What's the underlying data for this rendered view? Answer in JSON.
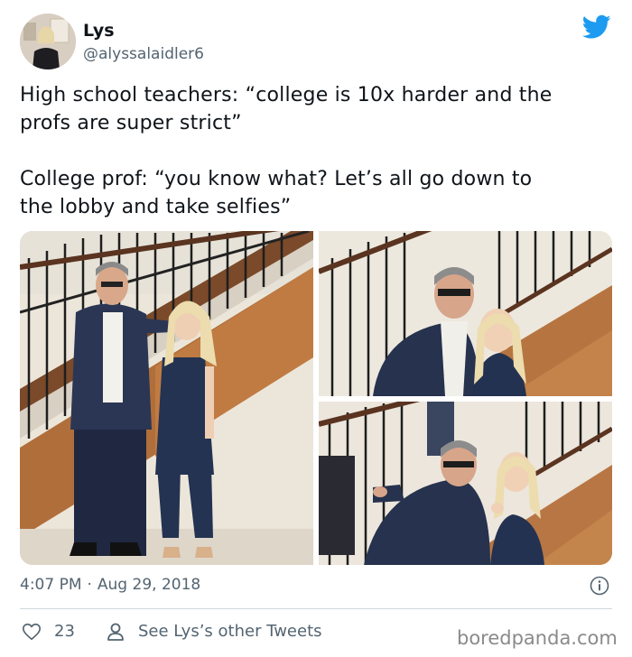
{
  "author": {
    "display_name": "Lys",
    "handle": "@alyssalaidler6",
    "avatar_icon": "profile-photo"
  },
  "brand_icon": "twitter-bird-icon",
  "brand_color": "#1d9bf0",
  "tweet": {
    "paragraphs": [
      "High school teachers: “college is 10x harder and the\nprofs are super strict”",
      "College prof: “you know what? Let’s all go down to\nthe lobby and take selfies”"
    ]
  },
  "media": {
    "photo_count": 3
  },
  "meta": {
    "time": "4:07 PM",
    "separator": "·",
    "date": "Aug 29, 2018"
  },
  "actions": {
    "like_count": "23",
    "see_other_tweets": "See Lys’s other Tweets"
  },
  "watermark": "boredpanda.com"
}
